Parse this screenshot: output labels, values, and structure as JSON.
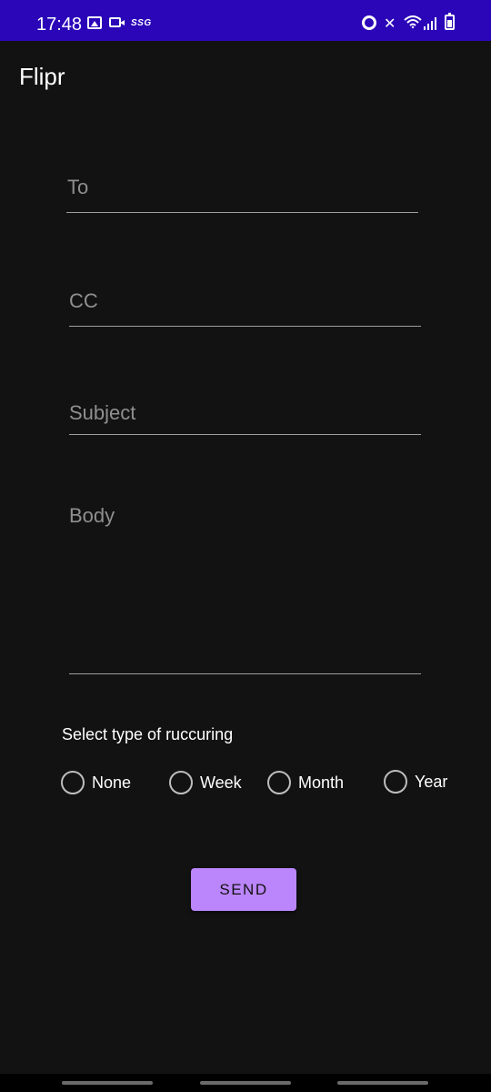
{
  "status_bar": {
    "time": "17:48",
    "carrier_badge": "SSG",
    "background_color": "#2a06b8",
    "icons": [
      "gallery-icon",
      "video-icon",
      "alarm-icon",
      "mute-icon",
      "wifi-icon",
      "signal-icon",
      "battery-icon"
    ]
  },
  "app_bar": {
    "title": "Flipr"
  },
  "form": {
    "to_label": "To",
    "cc_label": "CC",
    "subject_label": "Subject",
    "body_label": "Body"
  },
  "recurring": {
    "title": "Select type of ruccuring",
    "options": [
      {
        "label": "None",
        "selected": false
      },
      {
        "label": "Week",
        "selected": false
      },
      {
        "label": "Month",
        "selected": false
      },
      {
        "label": "Year",
        "selected": false
      }
    ]
  },
  "send_button": {
    "label": "SEND",
    "color": "#bb86fc"
  },
  "theme": {
    "background": "#121212",
    "hint_text": "#8f8f8f",
    "underline": "#9e9e9e"
  }
}
